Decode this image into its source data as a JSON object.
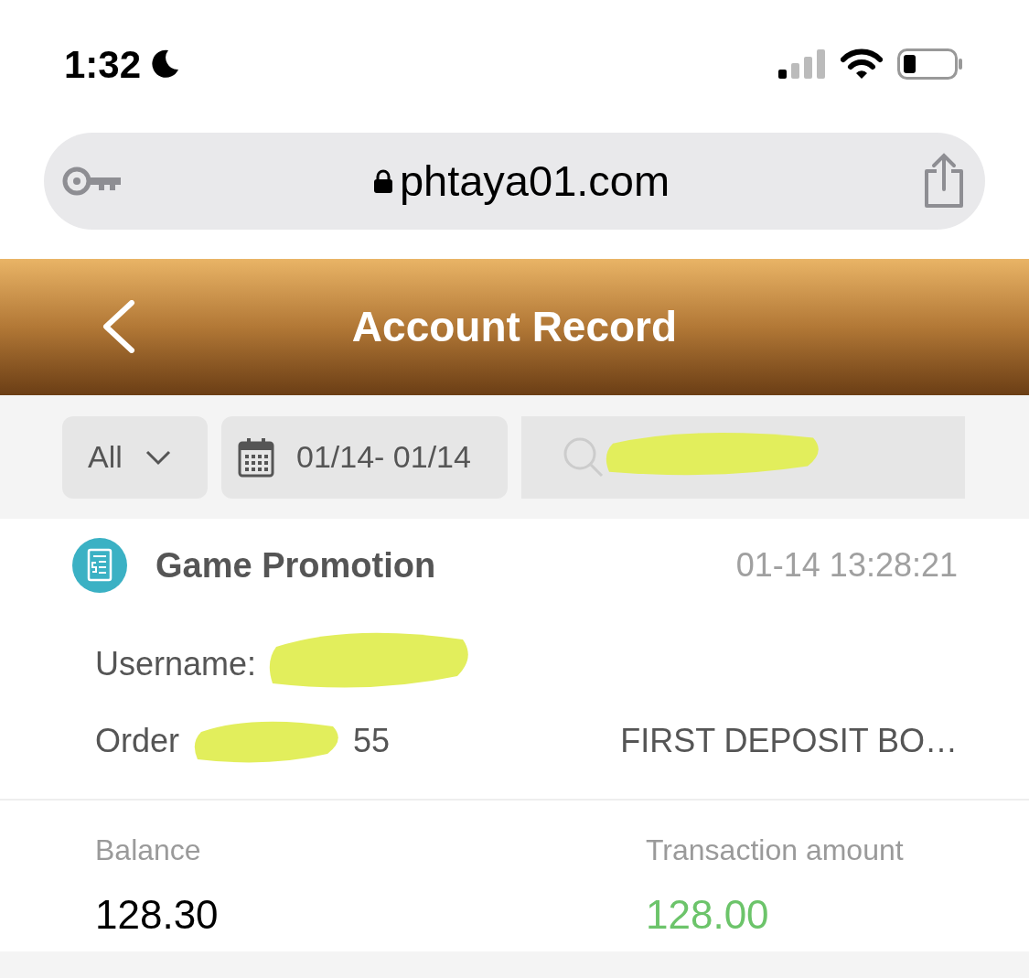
{
  "status_bar": {
    "time": "1:32"
  },
  "browser": {
    "url": "phtaya01.com"
  },
  "header": {
    "title": "Account Record"
  },
  "filters": {
    "type": "All",
    "date_range": "01/14- 01/14"
  },
  "record": {
    "title": "Game Promotion",
    "time": "01-14 13:28:21",
    "username_label": "Username:",
    "order_label": "Order",
    "order_tail": "55",
    "description": "FIRST DEPOSIT BO…",
    "balance_label": "Balance",
    "balance": "128.30",
    "amount_label": "Transaction amount",
    "amount": "128.00"
  }
}
